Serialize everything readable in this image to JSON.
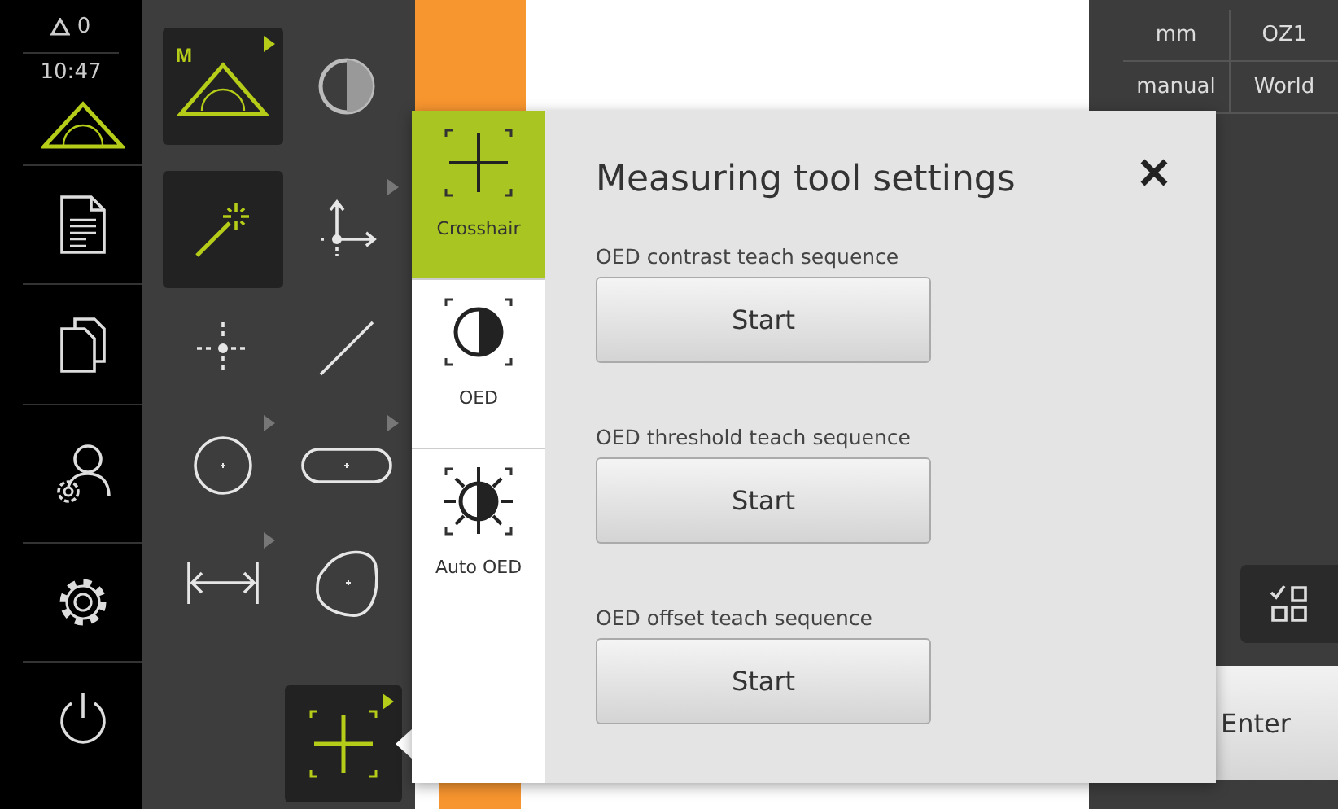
{
  "status": {
    "warnings": "0",
    "time": "10:47"
  },
  "sidebar": {
    "items": [
      {
        "kind": "measure"
      },
      {
        "kind": "report"
      },
      {
        "kind": "files"
      },
      {
        "kind": "user"
      },
      {
        "kind": "settings"
      },
      {
        "kind": "power"
      }
    ]
  },
  "tools": [
    {
      "kind": "manual",
      "badge": "M",
      "selected": true,
      "submenu": true
    },
    {
      "kind": "contrast",
      "selected": false,
      "submenu": false
    },
    {
      "kind": "wand",
      "selected": true,
      "submenu": false
    },
    {
      "kind": "axes",
      "selected": false,
      "submenu": true
    },
    {
      "kind": "point",
      "selected": false,
      "submenu": false
    },
    {
      "kind": "line",
      "selected": false,
      "submenu": false
    },
    {
      "kind": "circle",
      "selected": false,
      "submenu": true
    },
    {
      "kind": "slot",
      "selected": false,
      "submenu": true
    },
    {
      "kind": "distance",
      "selected": false,
      "submenu": true
    },
    {
      "kind": "blob",
      "selected": false,
      "submenu": false
    }
  ],
  "active_tool": {
    "kind": "crosshair",
    "submenu": true
  },
  "right_panel": {
    "cells": [
      "mm",
      "OZ1",
      "manual",
      "World"
    ],
    "enter_button": "Enter"
  },
  "popup": {
    "title": "Measuring tool settings",
    "tabs": [
      {
        "label": "Crosshair",
        "kind": "crosshair",
        "selected": true
      },
      {
        "label": "OED",
        "kind": "oed",
        "selected": false
      },
      {
        "label": "Auto OED",
        "kind": "auto-oed",
        "selected": false
      }
    ],
    "sections": [
      {
        "label": "OED contrast teach sequence",
        "button": "Start"
      },
      {
        "label": "OED threshold teach sequence",
        "button": "Start"
      },
      {
        "label": "OED offset teach sequence",
        "button": "Start"
      }
    ]
  }
}
